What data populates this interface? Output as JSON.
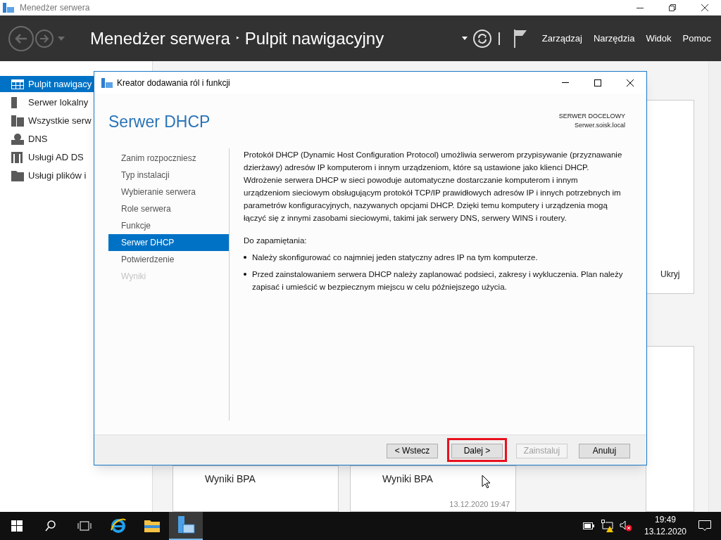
{
  "window": {
    "title": "Menedżer serwera"
  },
  "header": {
    "breadcrumb": [
      "Menedżer serwera",
      "Pulpit nawigacyjny"
    ],
    "separator": "‣",
    "menu": [
      "Zarządzaj",
      "Narzędzia",
      "Widok",
      "Pomoc"
    ]
  },
  "sidebar": {
    "items": [
      {
        "label": "Pulpit nawigacy",
        "selected": true
      },
      {
        "label": "Serwer lokalny",
        "selected": false
      },
      {
        "label": "Wszystkie serw",
        "selected": false
      },
      {
        "label": "DNS",
        "selected": false
      },
      {
        "label": "Usługi AD DS",
        "selected": false
      },
      {
        "label": "Usługi plików i",
        "selected": false
      }
    ]
  },
  "background": {
    "hide_label": "Ukryj",
    "cards": [
      {
        "title": "Wyniki BPA"
      },
      {
        "title": "Wyniki BPA",
        "timestamp": "13.12.2020 19:47"
      }
    ]
  },
  "dialog": {
    "title": "Kreator dodawania ról i funkcji",
    "heading": "Serwer DHCP",
    "target_label": "SERWER DOCELOWY",
    "target_server": "Serwer.soisk.local",
    "steps": [
      {
        "label": "Zanim rozpoczniesz",
        "selected": false,
        "disabled": false
      },
      {
        "label": "Typ instalacji",
        "selected": false,
        "disabled": false
      },
      {
        "label": "Wybieranie serwera",
        "selected": false,
        "disabled": false
      },
      {
        "label": "Role serwera",
        "selected": false,
        "disabled": false
      },
      {
        "label": "Funkcje",
        "selected": false,
        "disabled": false
      },
      {
        "label": "Serwer DHCP",
        "selected": true,
        "disabled": false
      },
      {
        "label": "Potwierdzenie",
        "selected": false,
        "disabled": false
      },
      {
        "label": "Wyniki",
        "selected": false,
        "disabled": true
      }
    ],
    "description": "Protokół DHCP (Dynamic Host Configuration Protocol) umożliwia serwerom przypisywanie (przyznawanie dzierżawy) adresów IP komputerom i innym urządzeniom, które są ustawione jako klienci DHCP. Wdrożenie serwera DHCP w sieci powoduje automatyczne dostarczanie komputerom i innym urządzeniom sieciowym obsługującym protokół TCP/IP prawidłowych adresów IP i innych potrzebnych im parametrów konfiguracyjnych, nazywanych opcjami DHCP. Dzięki temu komputery i urządzenia mogą łączyć się z innymi zasobami sieciowymi, takimi jak serwery DNS, serwery WINS i routery.",
    "note_heading": "Do zapamiętania:",
    "bullets": [
      "Należy skonfigurować co najmniej jeden statyczny adres IP na tym komputerze.",
      "Przed zainstalowaniem serwera DHCP należy zaplanować podsieci, zakresy i wykluczenia. Plan należy zapisać i umieścić w bezpiecznym miejscu w celu późniejszego użycia."
    ],
    "buttons": [
      {
        "label": "< Wstecz",
        "disabled": false,
        "highlighted": false
      },
      {
        "label": "Dalej >",
        "disabled": false,
        "highlighted": true
      },
      {
        "label": "Zainstaluj",
        "disabled": true,
        "highlighted": false
      },
      {
        "label": "Anuluj",
        "disabled": false,
        "highlighted": false
      }
    ]
  },
  "taskbar": {
    "time": "19:49",
    "date": "13.12.2020"
  }
}
